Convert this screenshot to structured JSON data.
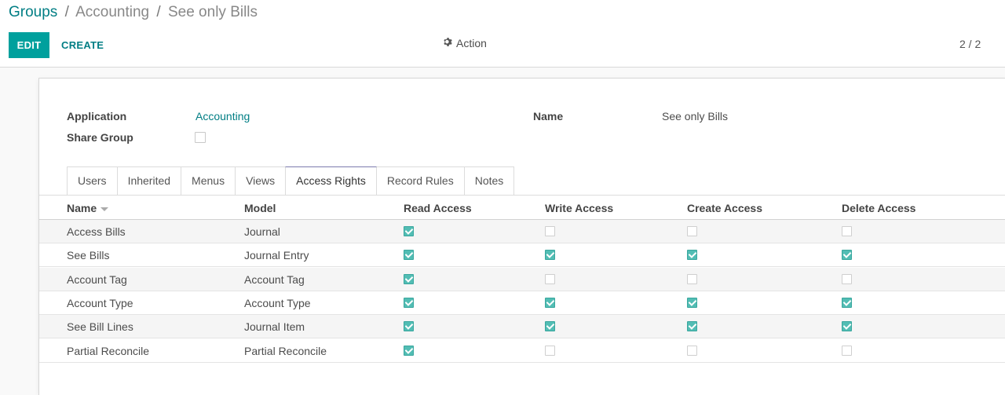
{
  "breadcrumb": {
    "root": "Groups",
    "separator": "/",
    "parent": "Accounting",
    "current": "See only Bills"
  },
  "toolbar": {
    "edit_label": "EDIT",
    "create_label": "CREATE",
    "action_label": "Action",
    "pager": "2 / 2"
  },
  "form": {
    "application_label": "Application",
    "application_value": "Accounting",
    "name_label": "Name",
    "name_value": "See only Bills",
    "share_group_label": "Share Group",
    "share_group_checked": false
  },
  "tabs": [
    {
      "label": "Users",
      "active": false
    },
    {
      "label": "Inherited",
      "active": false
    },
    {
      "label": "Menus",
      "active": false
    },
    {
      "label": "Views",
      "active": false
    },
    {
      "label": "Access Rights",
      "active": true
    },
    {
      "label": "Record Rules",
      "active": false
    },
    {
      "label": "Notes",
      "active": false
    }
  ],
  "table": {
    "headers": [
      "Name",
      "Model",
      "Read Access",
      "Write Access",
      "Create Access",
      "Delete Access"
    ],
    "rows": [
      {
        "name": "Access Bills",
        "model": "Journal",
        "read": true,
        "write": false,
        "create": false,
        "delete": false
      },
      {
        "name": "See Bills",
        "model": "Journal Entry",
        "read": true,
        "write": true,
        "create": true,
        "delete": true
      },
      {
        "name": "Account Tag",
        "model": "Account Tag",
        "read": true,
        "write": false,
        "create": false,
        "delete": false
      },
      {
        "name": "Account Type",
        "model": "Account Type",
        "read": true,
        "write": true,
        "create": true,
        "delete": true
      },
      {
        "name": "See Bill Lines",
        "model": "Journal Item",
        "read": true,
        "write": true,
        "create": true,
        "delete": true
      },
      {
        "name": "Partial Reconcile",
        "model": "Partial Reconcile",
        "read": true,
        "write": false,
        "create": false,
        "delete": false
      }
    ]
  },
  "colors": {
    "primary": "#00a09d",
    "link": "#017e84",
    "checkbox_checked": "#52bdb4"
  },
  "icons": {
    "action": "gear-icon",
    "sort": "caret-down-icon"
  }
}
